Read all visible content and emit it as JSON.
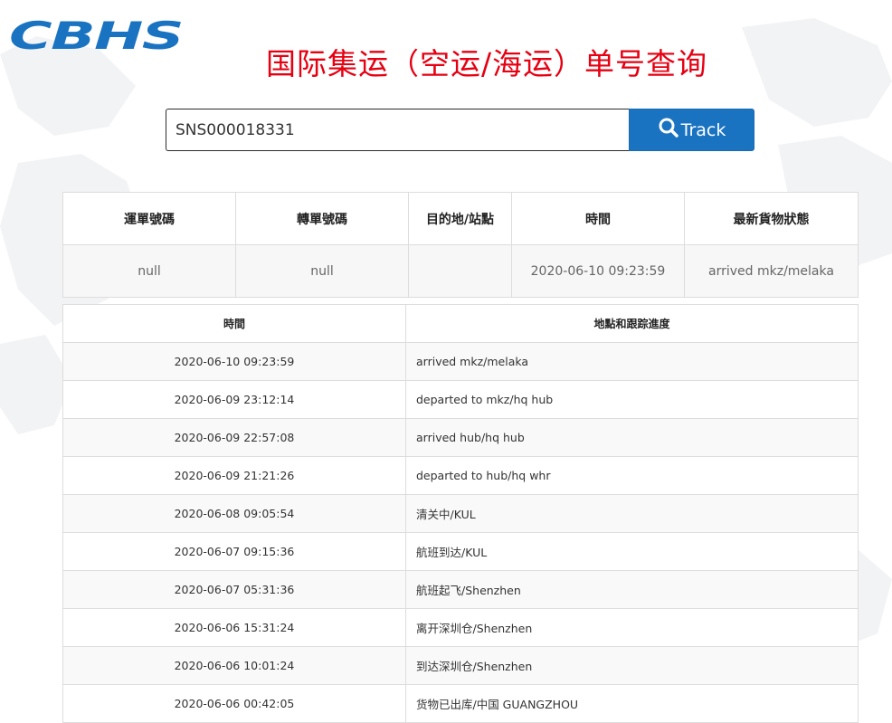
{
  "brand": {
    "logo_text": "CBHS",
    "color": "#1a73c1"
  },
  "page": {
    "title": "国际集运（空运/海运）单号查询",
    "title_color": "#e60012"
  },
  "search": {
    "value": "SNS000018331",
    "button_label": "Track",
    "button_icon": "search-icon",
    "button_color": "#1a73c1"
  },
  "summary": {
    "headers": [
      "運單號碼",
      "轉單號碼",
      "目的地/站點",
      "時間",
      "最新貨物狀態"
    ],
    "row": [
      "null",
      "null",
      "",
      "2020-06-10 09:23:59",
      "arrived mkz/melaka"
    ]
  },
  "history": {
    "headers": [
      "時間",
      "地點和跟踪進度"
    ],
    "rows": [
      {
        "time": "2020-06-10 09:23:59",
        "location": "arrived mkz/melaka"
      },
      {
        "time": "2020-06-09 23:12:14",
        "location": "departed to mkz/hq hub"
      },
      {
        "time": "2020-06-09 22:57:08",
        "location": "arrived hub/hq hub"
      },
      {
        "time": "2020-06-09 21:21:26",
        "location": "departed to hub/hq whr"
      },
      {
        "time": "2020-06-08 09:05:54",
        "location": "清关中/KUL"
      },
      {
        "time": "2020-06-07 09:15:36",
        "location": "航班到达/KUL"
      },
      {
        "time": "2020-06-07 05:31:36",
        "location": "航班起飞/Shenzhen"
      },
      {
        "time": "2020-06-06 15:31:24",
        "location": "离开深圳仓/Shenzhen"
      },
      {
        "time": "2020-06-06 10:01:24",
        "location": "到达深圳仓/Shenzhen"
      },
      {
        "time": "2020-06-06 00:42:05",
        "location": "货物已出库/中国 GUANGZHOU"
      }
    ]
  }
}
